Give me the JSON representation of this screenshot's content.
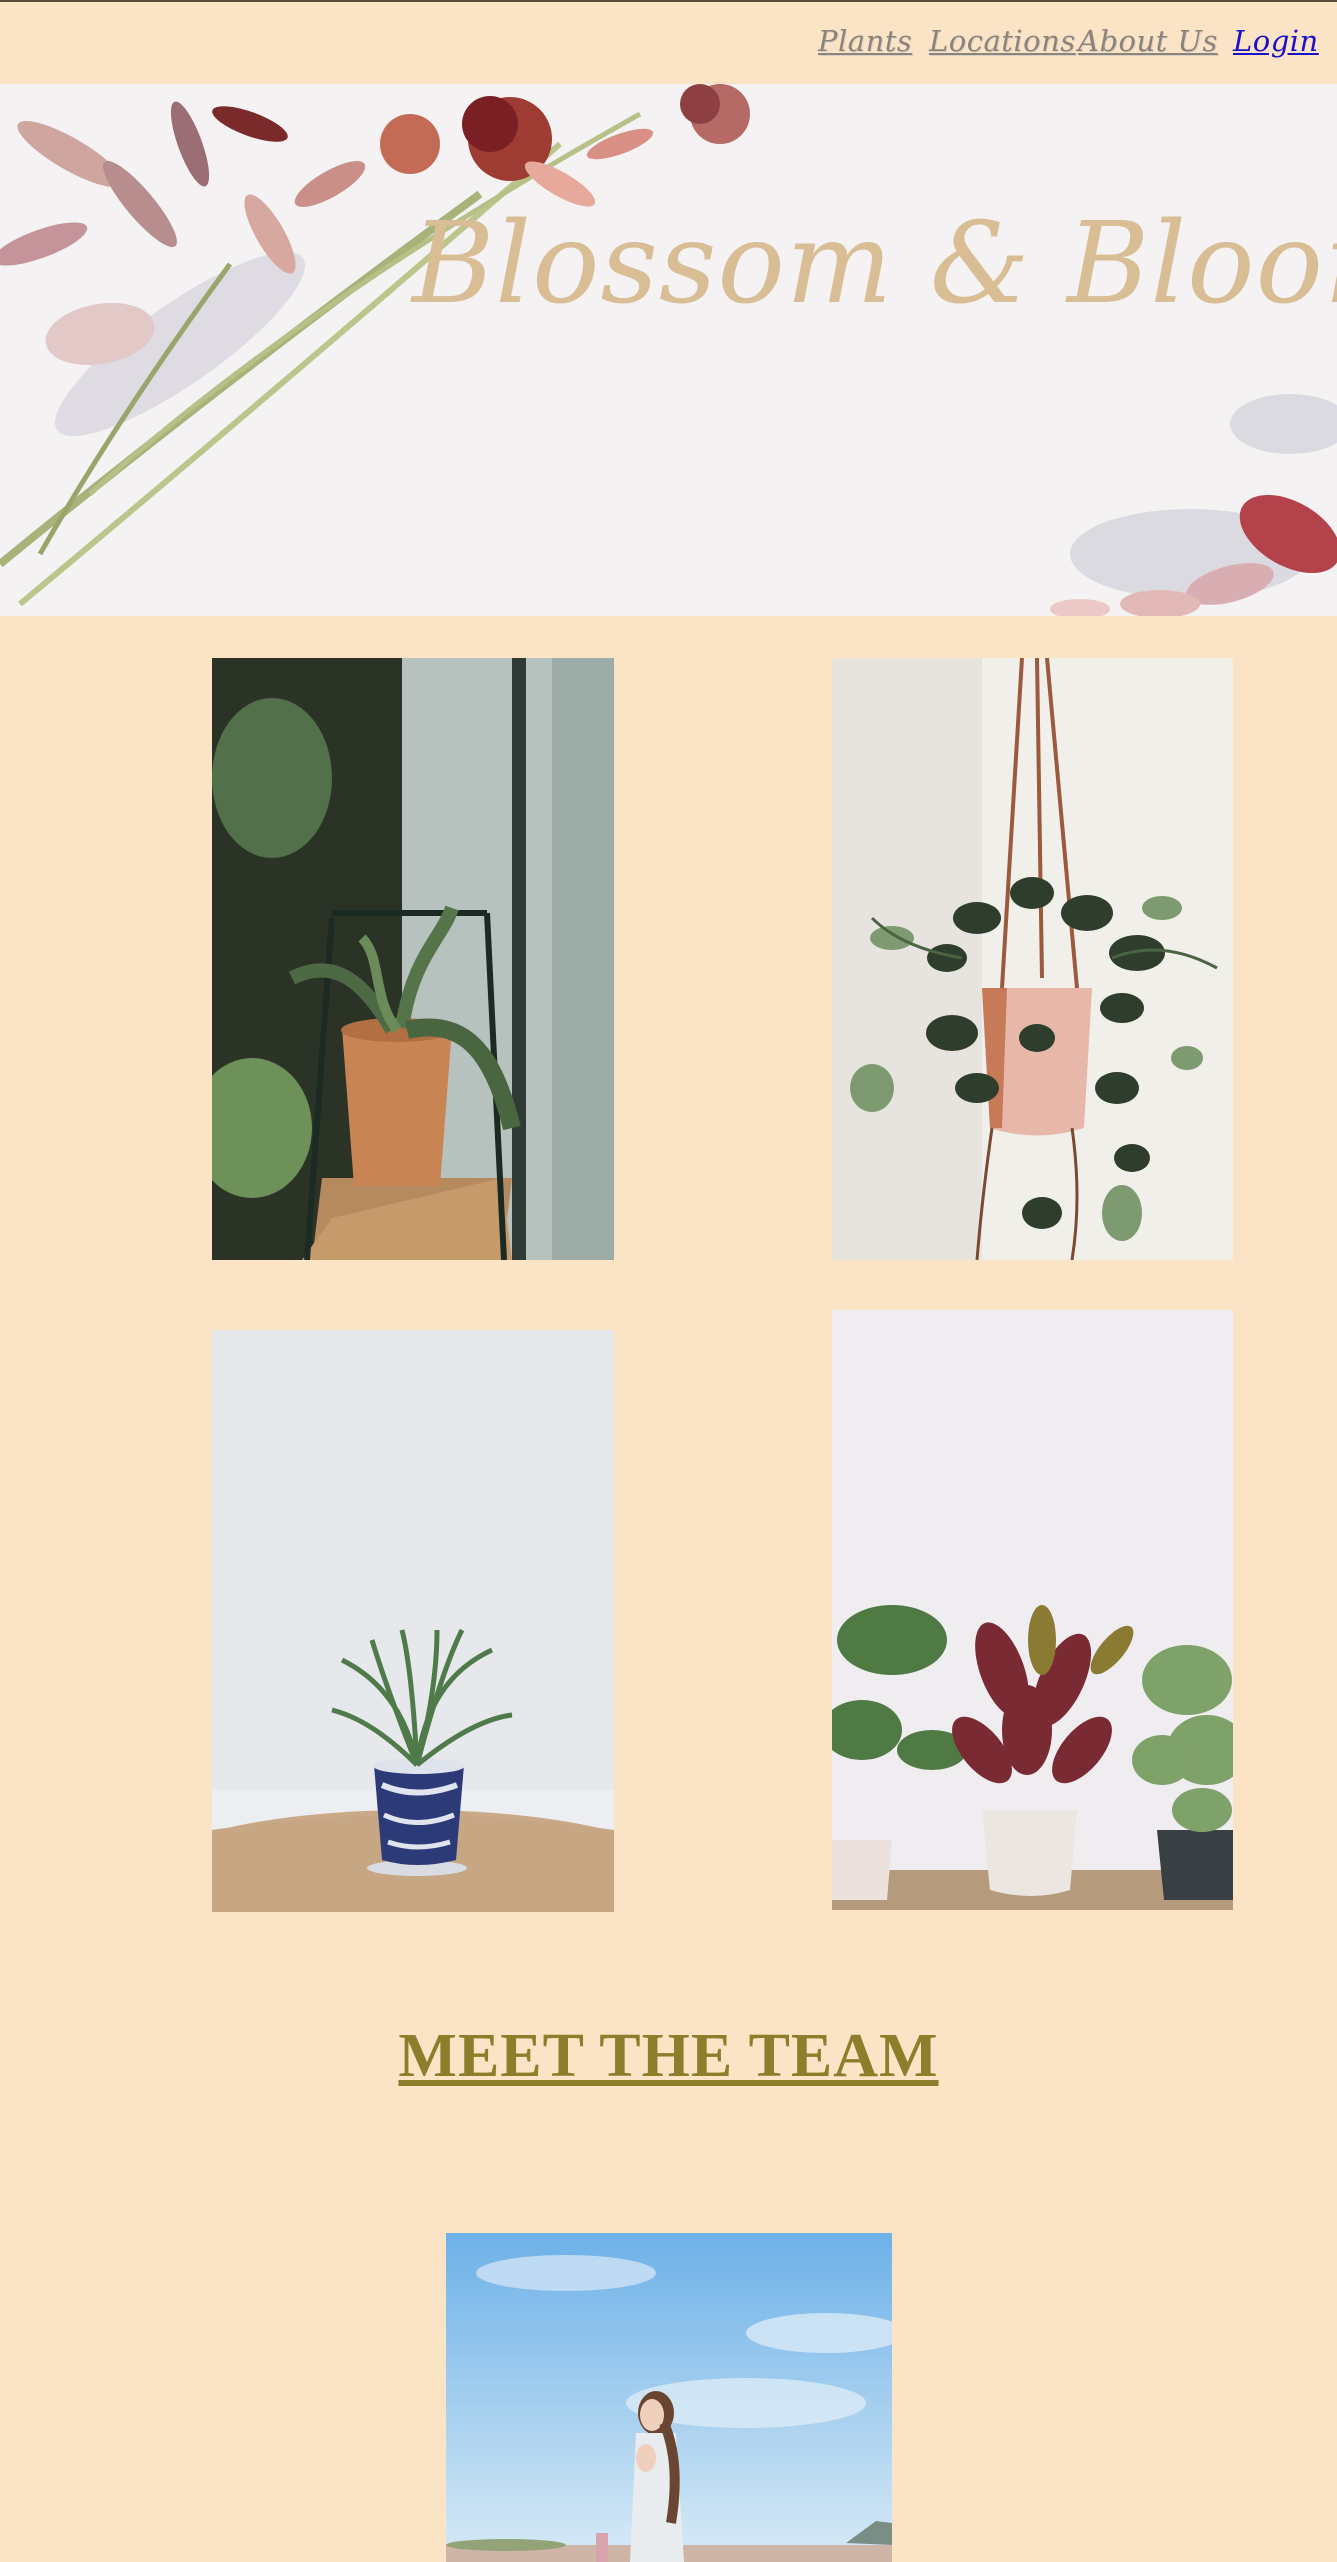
{
  "nav": {
    "items": [
      {
        "label": "Plants"
      },
      {
        "label": "Locations"
      },
      {
        "label": "About Us"
      },
      {
        "label": "Login"
      }
    ]
  },
  "hero": {
    "title": "Blossom & Bloom"
  },
  "gallery": {
    "photos": [
      {
        "subject": "snake plant in terracotta pot on windowsill"
      },
      {
        "subject": "hanging pothos in pink planter"
      },
      {
        "subject": "palm in blue patterned pot on wooden table"
      },
      {
        "subject": "three potted plants against white wall"
      }
    ]
  },
  "team": {
    "heading": "MEET THE TEAM",
    "photo": {
      "subject": "woman in flower field under blue sky"
    }
  },
  "colors": {
    "background": "#fbe3c6",
    "title": "#d8bd95",
    "heading": "#8c7f2b",
    "nav_link": "#8d8378",
    "login_link": "#1b11c8"
  }
}
